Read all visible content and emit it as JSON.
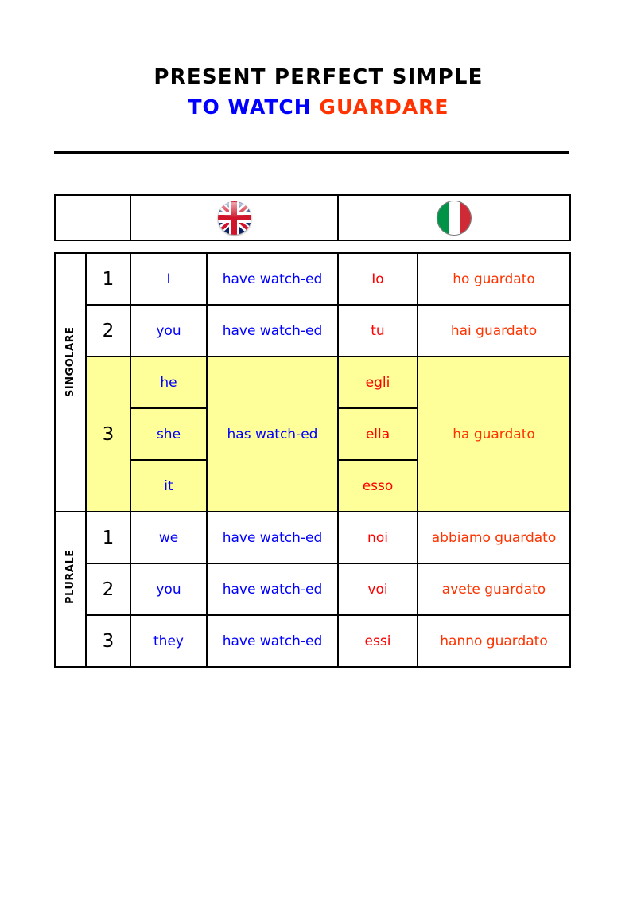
{
  "title": {
    "line1": "PRESENT PERFECT SIMPLE",
    "verb_en": "TO WATCH",
    "verb_it": "GUARDARE"
  },
  "colors": {
    "english": "#0000ff",
    "italian_pronoun": "#ff0000",
    "italian_verb": "#ff3300",
    "highlight": "#ffff99",
    "text": "#000000"
  },
  "flags": {
    "english": "uk-flag-icon",
    "italian": "italy-flag-icon"
  },
  "side_labels": {
    "singular": "SINGOLARE",
    "plural": "PLURALE"
  },
  "rows": [
    {
      "group": "singular",
      "num": "1",
      "pron_en": "I",
      "verb_en": "have watch-ed",
      "pron_it": "Io",
      "verb_it": "ho guardato",
      "highlight": false
    },
    {
      "group": "singular",
      "num": "2",
      "pron_en": "you",
      "verb_en": "have watch-ed",
      "pron_it": "tu",
      "verb_it": "hai guardato",
      "highlight": false
    },
    {
      "group": "singular",
      "num": "3",
      "pron_en": "he",
      "verb_en": "has watch-ed",
      "pron_it": "egli",
      "verb_it": "ha guardato",
      "highlight": true
    },
    {
      "group": "singular",
      "num": "",
      "pron_en": "she",
      "verb_en": "",
      "pron_it": "ella",
      "verb_it": "",
      "highlight": true
    },
    {
      "group": "singular",
      "num": "",
      "pron_en": "it",
      "verb_en": "",
      "pron_it": "esso",
      "verb_it": "",
      "highlight": true
    },
    {
      "group": "plural",
      "num": "1",
      "pron_en": "we",
      "verb_en": "have watch-ed",
      "pron_it": "noi",
      "verb_it": "abbiamo guardato",
      "highlight": false
    },
    {
      "group": "plural",
      "num": "2",
      "pron_en": "you",
      "verb_en": "have watch-ed",
      "pron_it": "voi",
      "verb_it": "avete guardato",
      "highlight": false
    },
    {
      "group": "plural",
      "num": "3",
      "pron_en": "they",
      "verb_en": "have watch-ed",
      "pron_it": "essi",
      "verb_it": "hanno guardato",
      "highlight": false
    }
  ]
}
